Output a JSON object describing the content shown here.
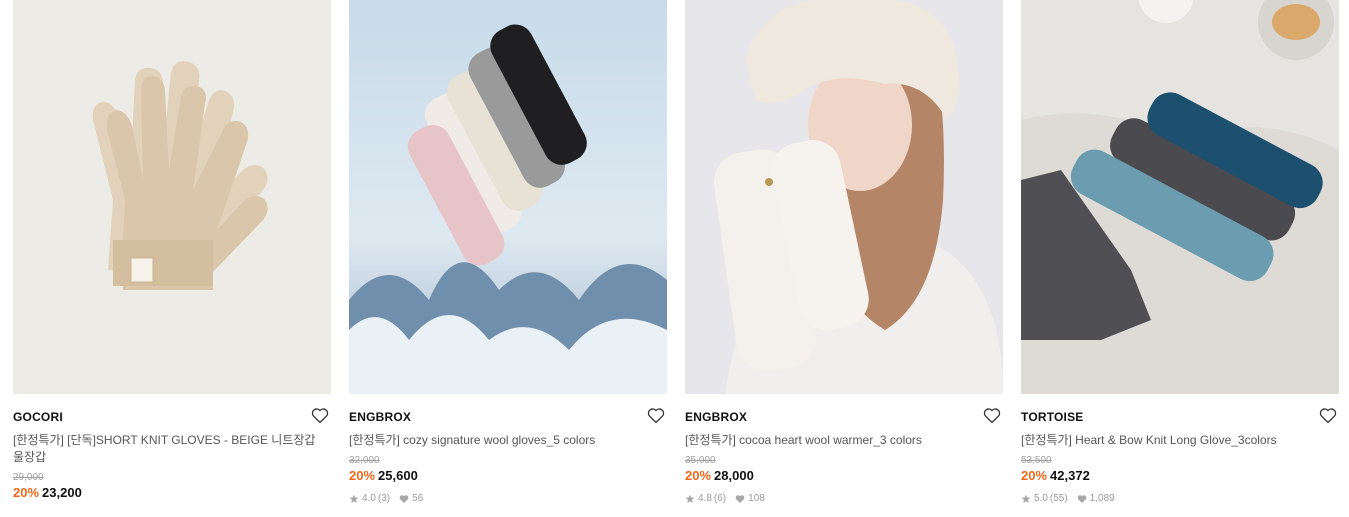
{
  "products": [
    {
      "brand": "GOCORI",
      "name": "[한정특가] [단독]SHORT KNIT GLOVES - BEIGE 니트장갑 울장갑",
      "original_price": "29,000",
      "discount": "20%",
      "price": "23,200",
      "rating": "",
      "reviews": "",
      "likes": "",
      "image": "beige-knit-gloves"
    },
    {
      "brand": "ENGBROX",
      "name": "[한정특가] cozy signature wool gloves_5 colors",
      "original_price": "32,000",
      "discount": "20%",
      "price": "25,600",
      "rating": "4.0",
      "reviews": "(3)",
      "likes": "56",
      "image": "five-color-gloves-snow"
    },
    {
      "brand": "ENGBROX",
      "name": "[한정특가] cocoa heart wool warmer_3 colors",
      "original_price": "35,000",
      "discount": "20%",
      "price": "28,000",
      "rating": "4.8",
      "reviews": "(6)",
      "likes": "108",
      "image": "model-white-warmer"
    },
    {
      "brand": "TORTOISE",
      "name": "[한정특가] Heart & Bow Knit Long Glove_3colors",
      "original_price": "53,500",
      "discount": "20%",
      "price": "42,372",
      "rating": "5.0",
      "reviews": "(55)",
      "likes": "1,089",
      "image": "long-gloves-on-sheet"
    }
  ],
  "colors": {
    "discount": "#f2661c",
    "text": "#111111",
    "muted": "#9a9a9a"
  },
  "icons": {
    "wishlist": "heart-outline-icon",
    "rating": "star-icon",
    "likes": "heart-filled-icon"
  }
}
